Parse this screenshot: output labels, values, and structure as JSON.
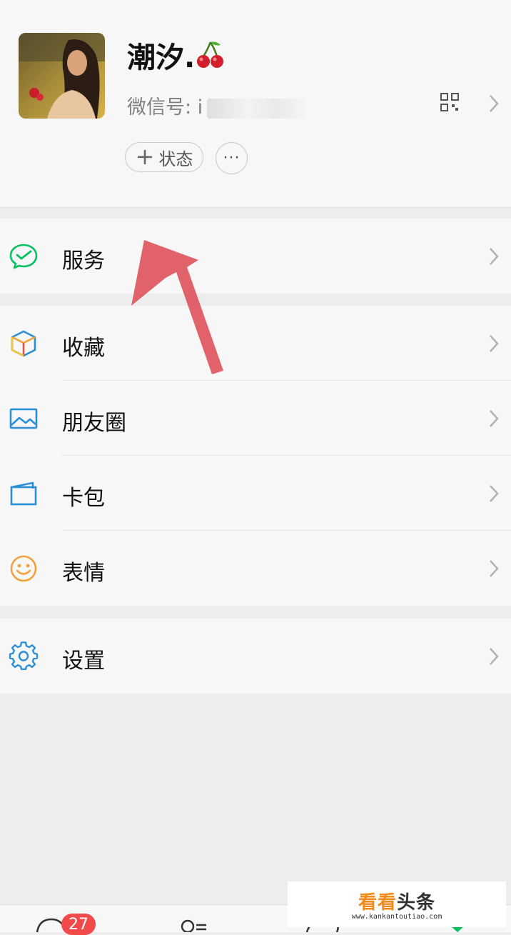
{
  "profile": {
    "nickname": "潮汐.",
    "nickname_emoji": "cherry-icon",
    "wechat_id_label": "微信号: i",
    "status_button": "状态",
    "more_button": "···"
  },
  "menu_groups": [
    {
      "items": [
        {
          "label": "服务",
          "icon": "wechat-pay-icon"
        }
      ]
    },
    {
      "items": [
        {
          "label": "收藏",
          "icon": "favorites-cube-icon"
        },
        {
          "label": "朋友圈",
          "icon": "moments-image-icon"
        },
        {
          "label": "卡包",
          "icon": "card-wallet-icon"
        },
        {
          "label": "表情",
          "icon": "sticker-smiley-icon"
        }
      ]
    },
    {
      "items": [
        {
          "label": "设置",
          "icon": "settings-gear-icon"
        }
      ]
    }
  ],
  "tabbar": {
    "chats_badge": "27"
  },
  "watermark": {
    "title_a": "看看",
    "title_b": "头条",
    "url": "www.kankantoutiao.com"
  },
  "colors": {
    "green": "#07c160",
    "blue": "#2b8fd6",
    "orange": "#f3a13a",
    "annotation": "#e05a63",
    "badge": "#f24a4a"
  }
}
